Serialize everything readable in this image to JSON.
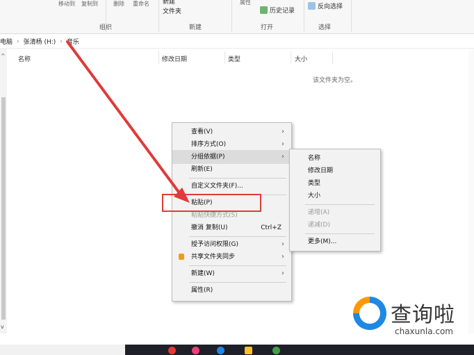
{
  "ribbon": {
    "cut_labels": [
      "移动到",
      "复制到"
    ],
    "delete_label": "删除",
    "rename_label": "重命名",
    "new_folder_top": "新建",
    "new_folder_bottom": "文件夹",
    "properties_label": "属性",
    "history_label": "历史记录",
    "invert_select_label": "反向选择",
    "groups": {
      "organize": "组织",
      "new": "新建",
      "open": "打开",
      "select": "选择"
    }
  },
  "address": {
    "crumbs": [
      "电脑",
      "张清杨 (H:)",
      "音乐"
    ]
  },
  "columns": {
    "name": "名称",
    "modified": "修改日期",
    "type": "类型",
    "size": "大小"
  },
  "empty_message": "该文件夹为空。",
  "context_menu": {
    "items": [
      {
        "label": "查看(V)",
        "submenu": true
      },
      {
        "label": "排序方式(O)",
        "submenu": true
      },
      {
        "label": "分组依据(P)",
        "submenu": true
      },
      {
        "label": "刷新(E)"
      },
      {
        "label": "自定义文件夹(F)..."
      },
      {
        "label": "粘贴(P)"
      },
      {
        "label": "粘贴快捷方式(S)"
      },
      {
        "label": "撤消 复制(U)",
        "shortcut": "Ctrl+Z"
      },
      {
        "label": "授予访问权限(G)",
        "submenu": true
      },
      {
        "label": "共享文件夹同步",
        "submenu": true
      },
      {
        "label": "新建(W)",
        "submenu": true
      },
      {
        "label": "属性(R)"
      }
    ]
  },
  "submenu": {
    "items": [
      {
        "label": "名称"
      },
      {
        "label": "修改日期"
      },
      {
        "label": "类型"
      },
      {
        "label": "大小"
      },
      {
        "label": "递增(A)"
      },
      {
        "label": "递减(D)"
      },
      {
        "label": "更多(M)..."
      }
    ]
  },
  "watermark": {
    "brand": "查询啦",
    "domain": "chaxunla.com"
  },
  "colors": {
    "annotation_red": "#e03a3a",
    "accent_blue": "#1e88e5"
  }
}
